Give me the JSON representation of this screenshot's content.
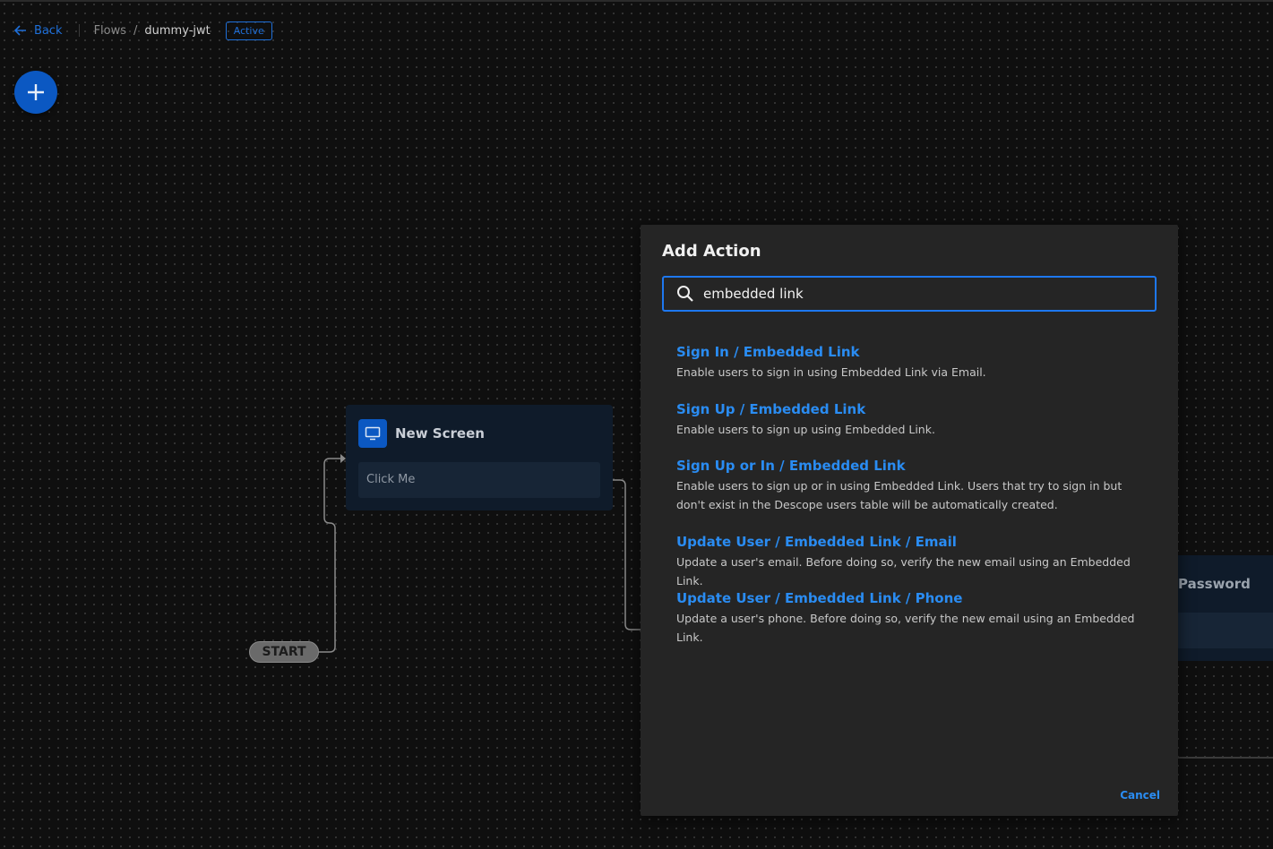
{
  "header": {
    "back_label": "Back",
    "breadcrumb_root": "Flows",
    "breadcrumb_separator": "/",
    "breadcrumb_current": "dummy-jwt",
    "status_badge": "Active"
  },
  "canvas": {
    "screen_node": {
      "title": "New Screen",
      "button_label": "Click Me",
      "icon": "monitor-icon"
    },
    "start_label": "START",
    "partial_node_title": "Password"
  },
  "modal": {
    "title": "Add Action",
    "search": {
      "value": "embedded link",
      "icon": "search-icon"
    },
    "results": [
      {
        "title": "Sign In / Embedded Link",
        "description": "Enable users to sign in using Embedded Link via Email."
      },
      {
        "title": "Sign Up / Embedded Link",
        "description": "Enable users to sign up using Embedded Link."
      },
      {
        "title": "Sign Up or In / Embedded Link",
        "description": "Enable users to sign up or in using Embedded Link. Users that try to sign in but don't exist in the Descope users table will be automatically created."
      },
      {
        "title": "Update User / Embedded Link / Email",
        "description": "Update a user's email. Before doing so, verify the new email using an Embedded Link."
      },
      {
        "title": "Update User / Embedded Link / Phone",
        "description": "Update a user's phone. Before doing so, verify the new email using an Embedded Link."
      }
    ],
    "cancel_label": "Cancel"
  },
  "colors": {
    "accent": "#1e78f0",
    "link": "#2a8cf2",
    "modal_bg": "#252525",
    "canvas_bg": "#0f0f0f"
  }
}
